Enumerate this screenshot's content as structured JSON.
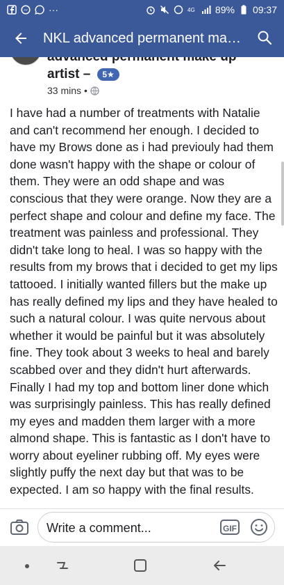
{
  "status_bar": {
    "icons_left": [
      "facebook-icon",
      "messenger-icon",
      "whatsapp-icon",
      "more-icon"
    ],
    "icons_right": [
      "alarm-icon",
      "mute-icon",
      "data-saver-icon",
      "network-4g-icon",
      "signal-icon"
    ],
    "battery": "89%",
    "time": "09:37"
  },
  "app_bar": {
    "title": "NKL advanced permanent make...",
    "back_icon": "arrow-left-icon",
    "search_icon": "search-icon"
  },
  "post": {
    "author_line1": "advanced permanent make up",
    "author_line2": "artist –",
    "rating": "5★",
    "time": "33 mins",
    "separator": "•",
    "privacy_icon": "globe-icon",
    "body": "I have had a number of treatments with Natalie and can't recommend her enough. I decided to have my Brows done as i had previouly had them done wasn't happy with the shape or colour of them. They were an odd shape and was conscious that they were orange. Now they are a perfect shape and colour and define my face. The treatment was painless and professional. They didn't take long to heal. I was so happy with the results from my brows that i decided to get my lips tattooed. I initially wanted fillers but the make up has really defined my lips and they have healed to such a natural colour. I was quite nervous about whether it would be painful but it was absolutely fine. They  took about 3 weeks to heal and barely scabbed over and they didn't hurt afterwards. Finally I had my top and bottom liner done which was surprisingly painless. This has really defined my eyes and madden them larger with a more almond shape. This is fantastic as I don't have to worry about eyeliner rubbing off. My eyes were slightly puffy the next day but that was to be expected. I am so happy with the final results."
  },
  "comment_bar": {
    "placeholder": "Write a comment...",
    "gif_label": "GIF",
    "camera_icon": "camera-icon",
    "emoji_icon": "smiley-icon"
  },
  "nav_bar": {
    "icons": [
      "dot-icon",
      "recent-apps-icon",
      "home-icon",
      "back-icon"
    ]
  },
  "colors": {
    "brand": "#3b5998",
    "badge": "#4267b2",
    "text": "#1c1e21"
  }
}
